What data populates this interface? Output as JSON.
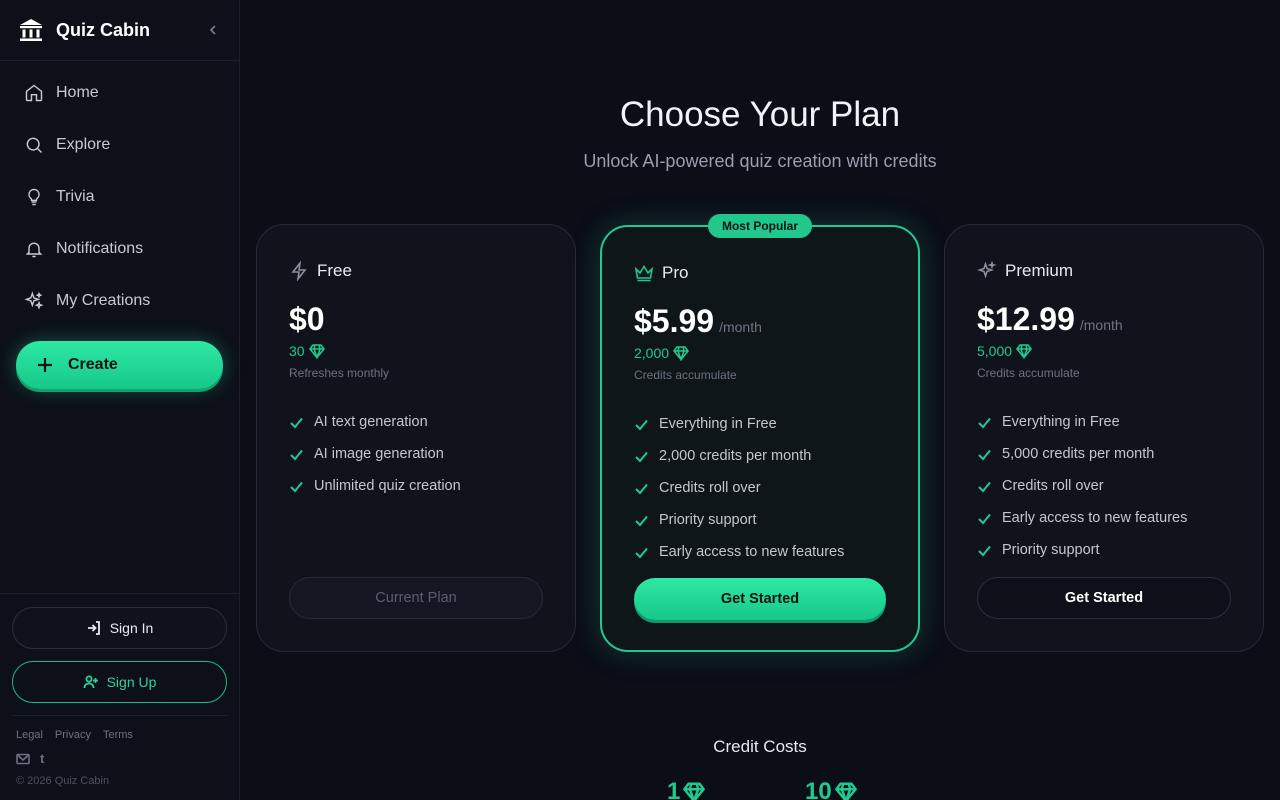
{
  "sidebar": {
    "brand": "Quiz Cabin",
    "nav": [
      {
        "label": "Home",
        "icon": "home-icon"
      },
      {
        "label": "Explore",
        "icon": "search-icon"
      },
      {
        "label": "Trivia",
        "icon": "lightbulb-icon"
      },
      {
        "label": "Notifications",
        "icon": "bell-icon"
      },
      {
        "label": "My Creations",
        "icon": "sparkles-icon"
      }
    ],
    "create_label": "Create",
    "sign_in": "Sign In",
    "sign_up": "Sign Up",
    "footer_links": [
      "Legal",
      "Privacy",
      "Terms"
    ],
    "copyright": "© 2026 Quiz Cabin"
  },
  "main": {
    "title": "Choose Your Plan",
    "subtitle": "Unlock AI-powered quiz creation with credits",
    "plans": [
      {
        "name": "Free",
        "price": "$0",
        "period": "",
        "credits": "30",
        "credits_note": "Refreshes monthly",
        "features": [
          "AI text generation",
          "AI image generation",
          "Unlimited quiz creation"
        ],
        "button": "Current Plan"
      },
      {
        "name": "Pro",
        "badge": "Most Popular",
        "price": "$5.99",
        "period": "/month",
        "credits": "2,000",
        "credits_note": "Credits accumulate",
        "features": [
          "Everything in Free",
          "2,000 credits per month",
          "Credits roll over",
          "Priority support",
          "Early access to new features"
        ],
        "button": "Get Started"
      },
      {
        "name": "Premium",
        "price": "$12.99",
        "period": "/month",
        "credits": "5,000",
        "credits_note": "Credits accumulate",
        "features": [
          "Everything in Free",
          "5,000 credits per month",
          "Credits roll over",
          "Early access to new features",
          "Priority support"
        ],
        "button": "Get Started"
      }
    ],
    "costs_title": "Credit Costs",
    "costs": [
      "1",
      "10"
    ]
  },
  "colors": {
    "accent": "#22c98e",
    "background": "#0b0d17"
  }
}
